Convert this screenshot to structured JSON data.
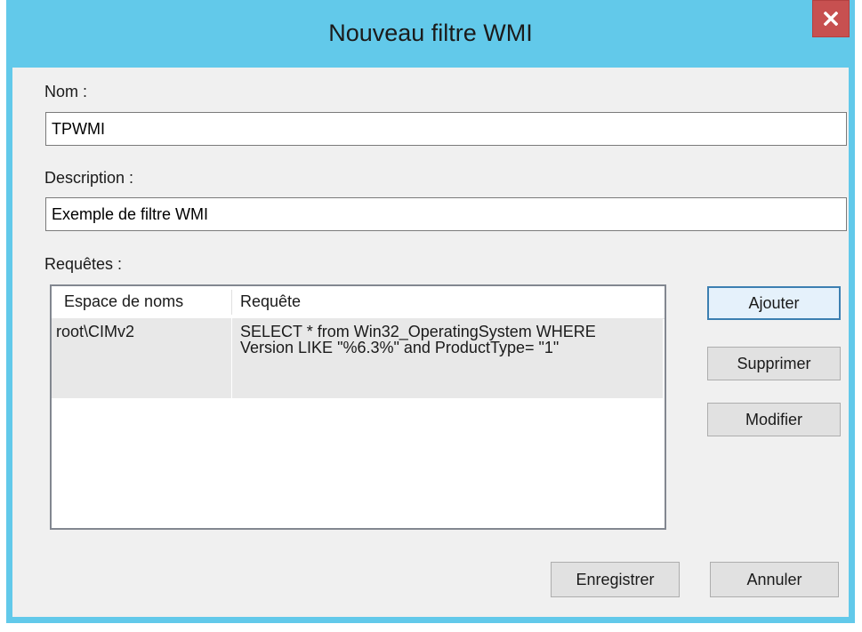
{
  "window": {
    "title": "Nouveau filtre WMI",
    "close_glyph": "x",
    "colors": {
      "titlebar": "#62c9ea",
      "close_button": "#c75050",
      "client": "#f0f0f0",
      "selected_row": "#e8e8e8"
    }
  },
  "form": {
    "name_label": "Nom :",
    "name_value": "TPWMI",
    "description_label": "Description :",
    "description_value": "Exemple de filtre WMI",
    "queries_label": "Requêtes :"
  },
  "queries_table": {
    "columns": [
      "Espace de noms",
      "Requête"
    ],
    "rows": [
      {
        "namespace": "root\\CIMv2",
        "query": "SELECT * from Win32_OperatingSystem WHERE Version LIKE \"%6.3%\" and ProductType= \"1\""
      }
    ]
  },
  "side_buttons": {
    "add": "Ajouter",
    "remove": "Supprimer",
    "edit": "Modifier"
  },
  "footer_buttons": {
    "save": "Enregistrer",
    "cancel": "Annuler"
  },
  "icons": {
    "close": "close-icon"
  }
}
